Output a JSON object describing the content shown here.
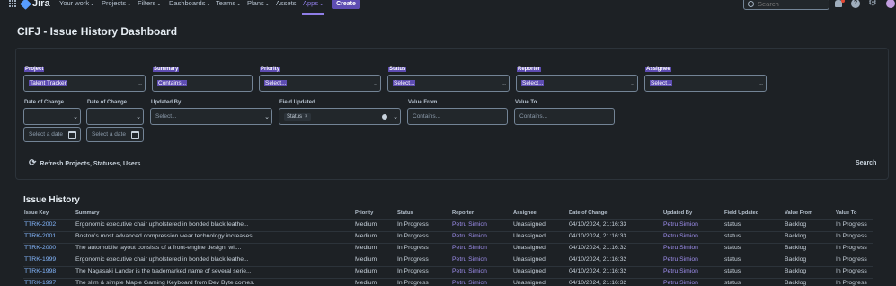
{
  "nav": {
    "brand": "Jira",
    "items": [
      {
        "label": "Your work",
        "chev": "⌄"
      },
      {
        "label": "Projects",
        "chev": "⌄"
      },
      {
        "label": "Filters",
        "chev": "⌄"
      },
      {
        "label": "Dashboards",
        "chev": "⌄"
      },
      {
        "label": "Teams",
        "chev": "⌄"
      },
      {
        "label": "Plans",
        "chev": "⌄"
      },
      {
        "label": "Assets",
        "chev": ""
      },
      {
        "label": "Apps",
        "chev": "⌄"
      }
    ],
    "create_label": "Create",
    "search_placeholder": "Search"
  },
  "page_title": "CIFJ - Issue History Dashboard",
  "filters": {
    "project": {
      "label": "Project",
      "value": "Talent Tracker"
    },
    "summary": {
      "label": "Summary",
      "value": "Contains..."
    },
    "priority": {
      "label": "Priority",
      "value": "Select..."
    },
    "status": {
      "label": "Status",
      "value": "Select..."
    },
    "reporter": {
      "label": "Reporter",
      "value": "Select..."
    },
    "assignee": {
      "label": "Assignee",
      "value": "Select..."
    },
    "date_of_change_1": {
      "label": "Date of Change",
      "placeholder": "Select a date"
    },
    "date_of_change_2": {
      "label": "Date of Change",
      "placeholder": "Select a date"
    },
    "updated_by": {
      "label": "Updated By",
      "value": "Select..."
    },
    "field_updated": {
      "label": "Field Updated",
      "tag": "Status",
      "tag_remove": "×"
    },
    "value_from": {
      "label": "Value From",
      "value": "Contains..."
    },
    "value_to": {
      "label": "Value To",
      "value": "Contains..."
    }
  },
  "refresh_label": "Refresh Projects, Statuses, Users",
  "search_label": "Search",
  "history": {
    "title": "Issue History",
    "columns": [
      "Issue Key",
      "Summary",
      "Priority",
      "Status",
      "Reporter",
      "Assignee",
      "Date of Change",
      "Updated By",
      "Field Updated",
      "Value From",
      "Value To"
    ],
    "rows": [
      [
        "TTRK-2002",
        "Ergonomic executive chair upholstered in bonded black leathe...",
        "Medium",
        "In Progress",
        "Petru Simion",
        "Unassigned",
        "04/10/2024, 21:16:33",
        "Petru Simion",
        "status",
        "Backlog",
        "In Progress"
      ],
      [
        "TTRK-2001",
        "Boston's most advanced compression wear technology increases...",
        "Medium",
        "In Progress",
        "Petru Simion",
        "Unassigned",
        "04/10/2024, 21:16:33",
        "Petru Simion",
        "status",
        "Backlog",
        "In Progress"
      ],
      [
        "TTRK-2000",
        "The automobile layout consists of a front-engine design, wit...",
        "Medium",
        "In Progress",
        "Petru Simion",
        "Unassigned",
        "04/10/2024, 21:16:32",
        "Petru Simion",
        "status",
        "Backlog",
        "In Progress"
      ],
      [
        "TTRK-1999",
        "Ergonomic executive chair upholstered in bonded black leathe...",
        "Medium",
        "In Progress",
        "Petru Simion",
        "Unassigned",
        "04/10/2024, 21:16:32",
        "Petru Simion",
        "status",
        "Backlog",
        "In Progress"
      ],
      [
        "TTRK-1998",
        "The Nagasaki Lander is the trademarked name of several serie...",
        "Medium",
        "In Progress",
        "Petru Simion",
        "Unassigned",
        "04/10/2024, 21:16:32",
        "Petru Simion",
        "status",
        "Backlog",
        "In Progress"
      ],
      [
        "TTRK-1997",
        "The slim & simple Maple Gaming Keyboard from Dev Byte comes...",
        "Medium",
        "In Progress",
        "Petru Simion",
        "Unassigned",
        "04/10/2024, 21:16:32",
        "Petru Simion",
        "status",
        "Backlog",
        "In Progress"
      ]
    ]
  }
}
